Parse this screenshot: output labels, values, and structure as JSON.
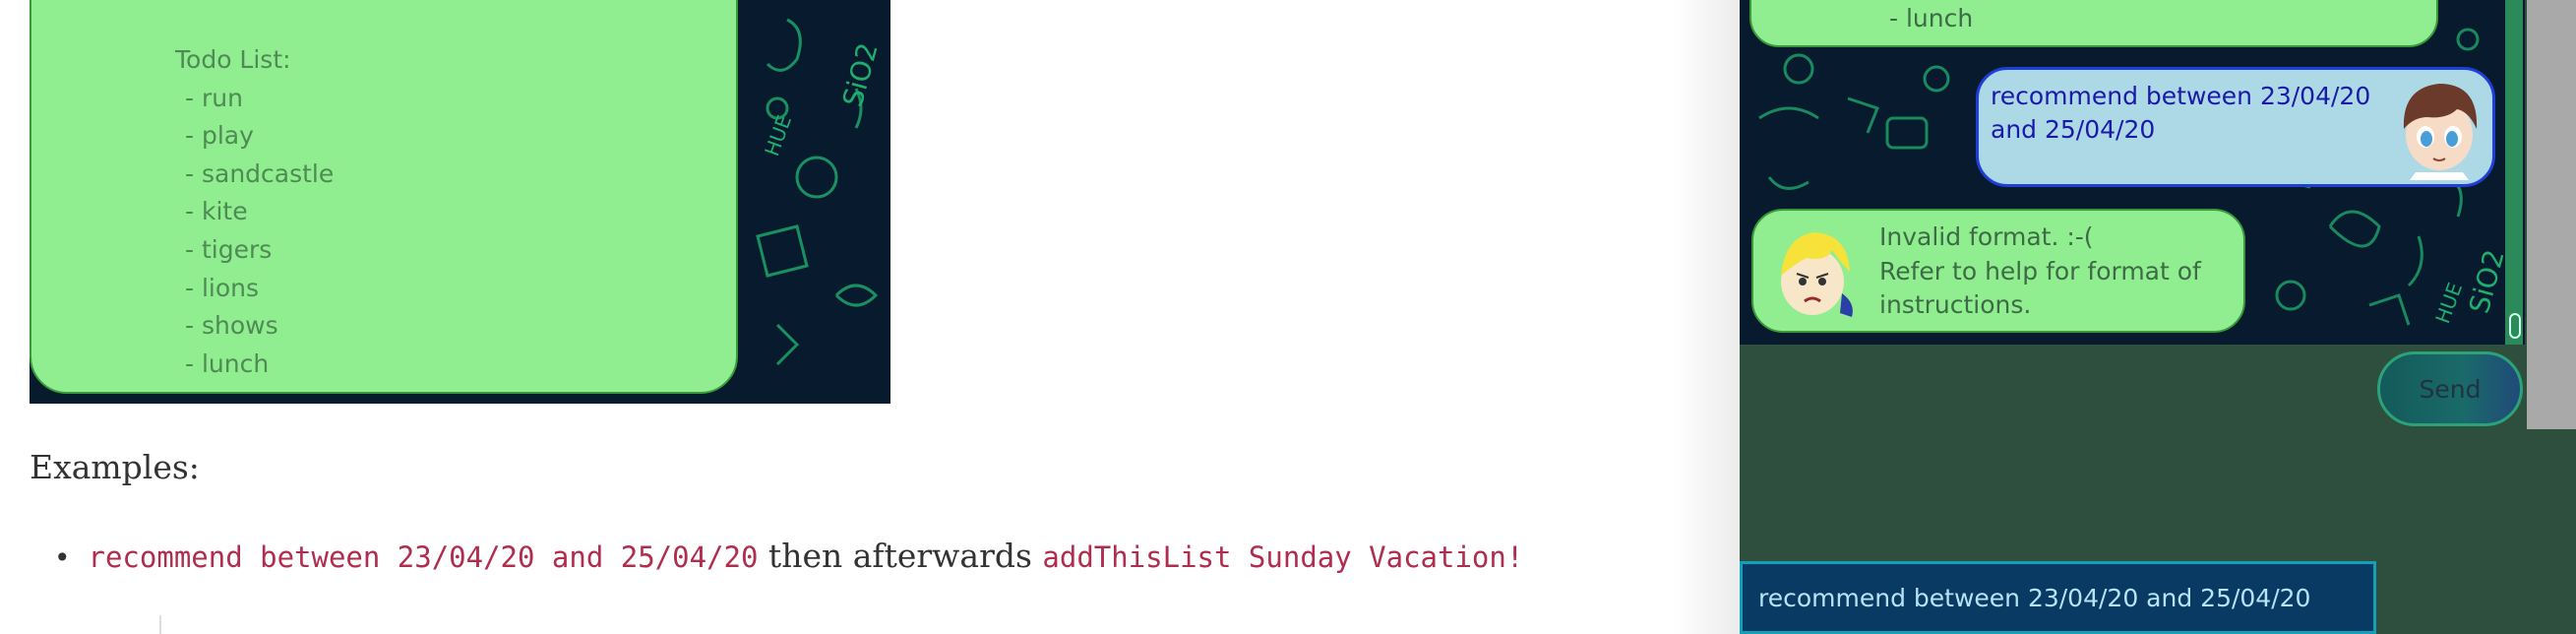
{
  "doc": {
    "todo_title": "Todo List:",
    "todo_items": [
      "- run",
      "- play",
      "- sandcastle",
      "- kite",
      "- tigers",
      "- lions",
      "- shows",
      "- lunch"
    ],
    "examples_heading": "Examples:",
    "example": {
      "bullet": "•",
      "code1": "recommend between 23/04/20 and 25/04/20",
      "connector": " then afterwards ",
      "code2": "addThisList Sunday Vacation!"
    }
  },
  "app": {
    "prev_message": "- lunch",
    "user_message": "recommend between 23/04/20 and 25/04/20",
    "duke_message_lines": [
      "Invalid format. :-(",
      "Refer to help for format of",
      "instructions."
    ],
    "send_label": "Send",
    "input_value": "recommend between 23/04/20 and 25/04/20"
  },
  "colors": {
    "bubble_green": "#90ee90",
    "bubble_blue": "#add8e6",
    "chat_bg": "#071a2e",
    "panel_bg": "#2f4f3e",
    "code_red": "#b02d4f"
  }
}
